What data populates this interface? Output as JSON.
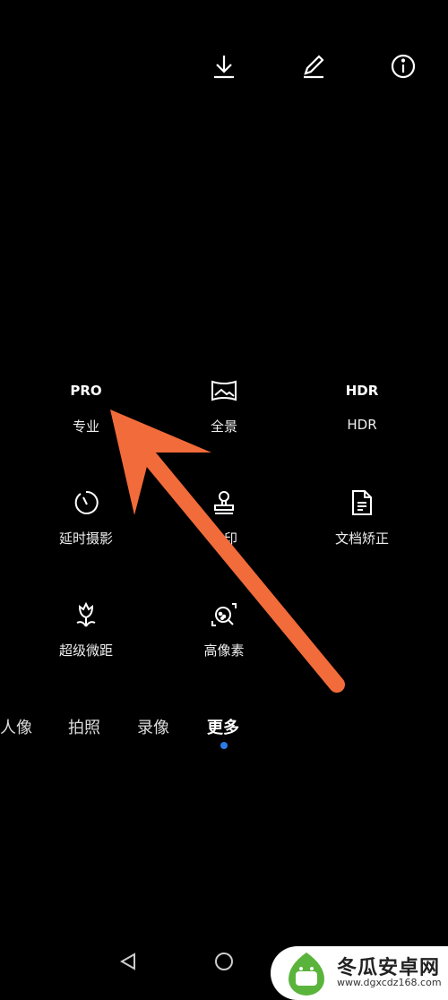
{
  "toolbar": {
    "icons": [
      "download-icon",
      "edit-icon",
      "info-icon"
    ]
  },
  "modes": [
    {
      "icon_text": "PRO",
      "label": "专业"
    },
    {
      "icon": "panorama-icon",
      "label": "全景"
    },
    {
      "icon_text": "HDR",
      "label": "HDR"
    },
    {
      "icon": "timelapse-icon",
      "label": "延时摄影"
    },
    {
      "icon": "stamp-icon",
      "label": "水印"
    },
    {
      "icon": "document-icon",
      "label": "文档矫正"
    },
    {
      "icon": "flower-icon",
      "label": "超级微距"
    },
    {
      "icon": "high-res-icon",
      "label": "高像素"
    }
  ],
  "tabs": [
    {
      "label": "人像"
    },
    {
      "label": "拍照"
    },
    {
      "label": "录像"
    },
    {
      "label": "更多",
      "active": true
    }
  ],
  "annotation": {
    "color": "#f26b3a"
  },
  "accent": "#2a7ae8",
  "watermark": {
    "title": "冬瓜安卓网",
    "url": "www.dgxcdz168.com",
    "brand_color": "#5ab43c"
  }
}
